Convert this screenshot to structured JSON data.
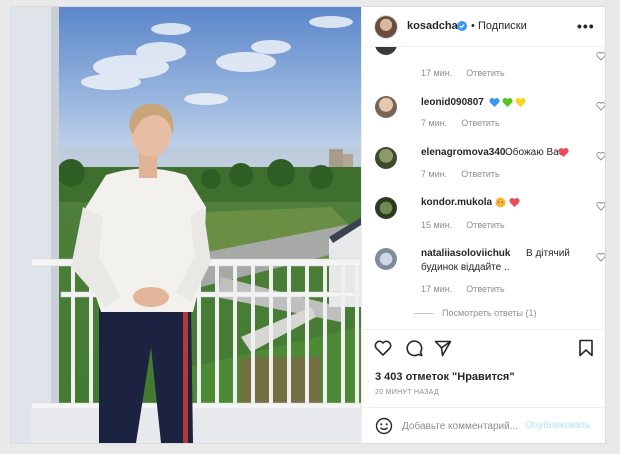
{
  "header": {
    "username": "kosadcha",
    "separator": "•",
    "follow_label": "Подписки",
    "more_label": "•••"
  },
  "comments": [
    {
      "username": "",
      "text": "",
      "time": "17 мин.",
      "reply_label": "Ответить",
      "hearts": []
    },
    {
      "username": "leonid090807",
      "text": "",
      "time": "7 мин.",
      "reply_label": "Ответить",
      "hearts": [
        "#3897f0",
        "#58c322",
        "#f7d51d"
      ]
    },
    {
      "username": "elenagromova340",
      "text": "Обожаю Вас",
      "time": "7 мин.",
      "reply_label": "Ответить",
      "hearts": [
        "#ed4956"
      ]
    },
    {
      "username": "kondor.mukola",
      "text": "",
      "time": "15 мин.",
      "reply_label": "Ответить",
      "hearts": [
        "#ed4956"
      ]
    },
    {
      "username": "nataliiasoloviichuk",
      "text": "В дітячий",
      "text2": "будинок віддайте ..",
      "time": "17 мин.",
      "reply_label": "Ответить",
      "hearts": []
    }
  ],
  "view_replies": "Посмотреть ответы (1)",
  "actions": {
    "like_icon": "heart-outline-icon",
    "comment_icon": "comment-icon",
    "share_icon": "paper-plane-icon",
    "save_icon": "bookmark-icon"
  },
  "likes_text": "3 403 отметок \"Нравится\"",
  "time_ago": "20 минут назад",
  "add_comment": {
    "placeholder": "Добавьте комментарий...",
    "post_label": "Опубликовать"
  },
  "colors": {
    "brand_blue": "#0095f6",
    "post_disabled": "#b2dffc",
    "muted": "#8e8e8e",
    "border": "#dbdbdb"
  }
}
